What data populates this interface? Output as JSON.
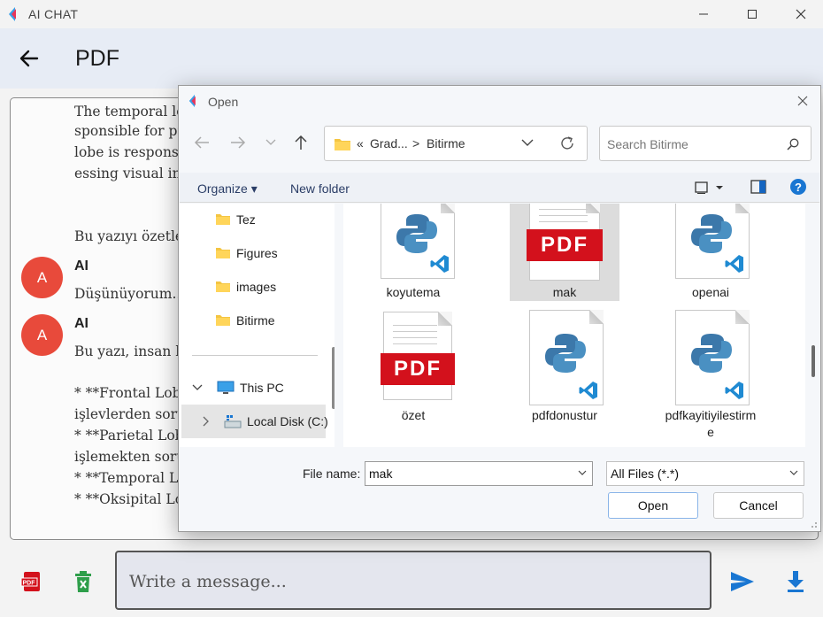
{
  "window": {
    "title": "AI CHAT"
  },
  "header": {
    "title": "PDF"
  },
  "chat": {
    "partial_lines": [
      "The temporal lo",
      "sponsible for pr",
      "lobe is respons",
      "essing visual int"
    ],
    "user_message": "Bu yazıyı özetle",
    "messages": [
      {
        "avatar_letter": "A",
        "sender": "AI",
        "text": "Düşünüyorum..."
      },
      {
        "avatar_letter": "A",
        "sender": "AI",
        "text": "Bu yazı, insan b"
      }
    ],
    "summary_lines": [
      "* **Frontal Lob:",
      "işlevlerden soru",
      "* **Parietal Lob",
      "işlemekten soru",
      "* **Temporal Lo",
      "* **Oksipital Lo"
    ]
  },
  "input": {
    "placeholder": "Write a message..."
  },
  "dialog": {
    "title": "Open",
    "address": {
      "prefix": "«",
      "segment1": "Grad...",
      "separator": ">",
      "segment2": "Bitirme"
    },
    "search_placeholder": "Search Bitirme",
    "commands": {
      "organize": "Organize",
      "new_folder": "New folder"
    },
    "nav": {
      "folders": [
        "Tez",
        "Figures",
        "images",
        "Bitirme"
      ],
      "this_pc": "This PC",
      "local_disk": "Local Disk (C:)"
    },
    "files": [
      {
        "name": "koyutema",
        "kind": "python"
      },
      {
        "name": "mak",
        "kind": "pdf",
        "selected": true
      },
      {
        "name": "openai",
        "kind": "python"
      },
      {
        "name": "özet",
        "kind": "pdf"
      },
      {
        "name": "pdfdonustur",
        "kind": "python"
      },
      {
        "name": "pdfkayitiyilestirme",
        "kind": "python",
        "label_line1": "pdfkayitiyilestirm",
        "label_line2": "e"
      }
    ],
    "pdf_badge": "PDF",
    "file_name_label": "File name:",
    "file_name_value": "mak",
    "file_type": "All Files (*.*)",
    "open_label": "Open",
    "cancel_label": "Cancel"
  },
  "colors": {
    "avatar": "#e84a3b",
    "accent": "#1976d2",
    "pdf_red": "#d3111c",
    "trash_green": "#2e9e4a"
  }
}
